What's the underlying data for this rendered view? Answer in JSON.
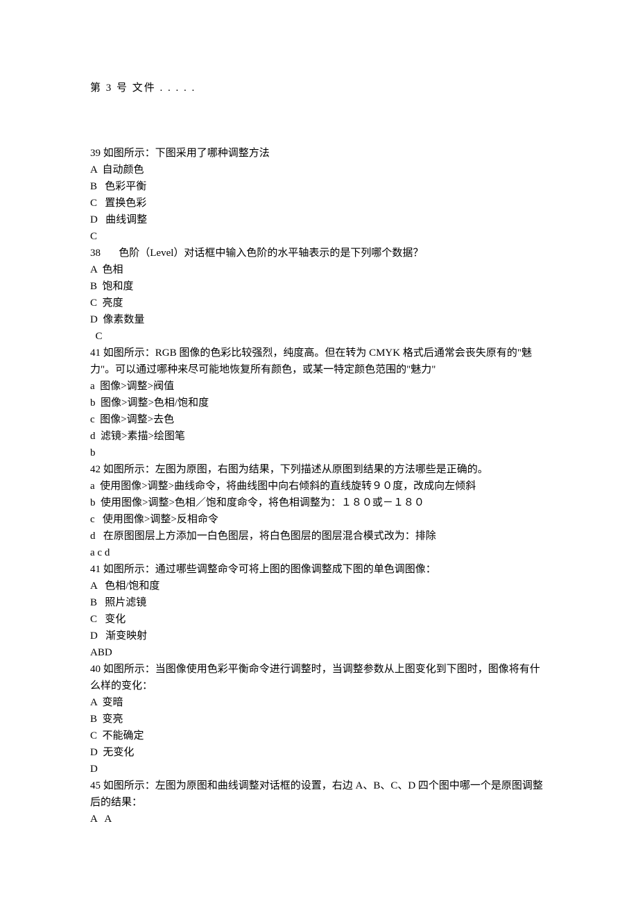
{
  "header": "第  3  号  文件  . . . . .",
  "lines": [
    "39 如图所示：下图采用了哪种调整方法",
    "A  自动颜色",
    "B   色彩平衡",
    "C   置换色彩",
    "D   曲线调整",
    "C",
    "38       色阶（Level）对话框中输入色阶的水平轴表示的是下列哪个数据？",
    "A  色相",
    "B  饱和度",
    "C  亮度",
    "D  像素数量",
    "  C",
    "41 如图所示：RGB 图像的色彩比较强烈，纯度高。但在转为 CMYK 格式后通常会丧失原有的\"魅力\"。可以通过哪种来尽可能地恢复所有颜色，或某一特定颜色范围的\"魅力\"",
    "a  图像>调整>阀值",
    "b  图像>调整>色相/饱和度",
    "c  图像>调整>去色",
    "d  滤镜>素描>绘图笔",
    "b",
    "42 如图所示：左图为原图，右图为结果，下列描述从原图到结果的方法哪些是正确的。",
    "a  使用图像>调整>曲线命令，将曲线图中向右倾斜的直线旋转９０度，改成向左倾斜",
    "b  使用图像>调整>色相／饱和度命令，将色相调整为：１８０或－１８０",
    "c   使用图像>调整>反相命令",
    "d   在原图图层上方添加一白色图层，将白色图层的图层混合模式改为：排除",
    "a c d",
    "41 如图所示：通过哪些调整命令可将上图的图像调整成下图的单色调图像：",
    "A   色相/饱和度",
    "B   照片滤镜",
    "C   变化",
    "D   渐变映射",
    "ABD",
    "40 如图所示：当图像使用色彩平衡命令进行调整时，当调整参数从上图变化到下图时，图像将有什么样的变化：",
    "A  变暗",
    "B  变亮",
    "C  不能确定",
    "D  无变化",
    "D",
    "45 如图所示：左图为原图和曲线调整对话框的设置，右边 A、B、C、D 四个图中哪一个是原图调整后的结果：",
    "A   A"
  ]
}
